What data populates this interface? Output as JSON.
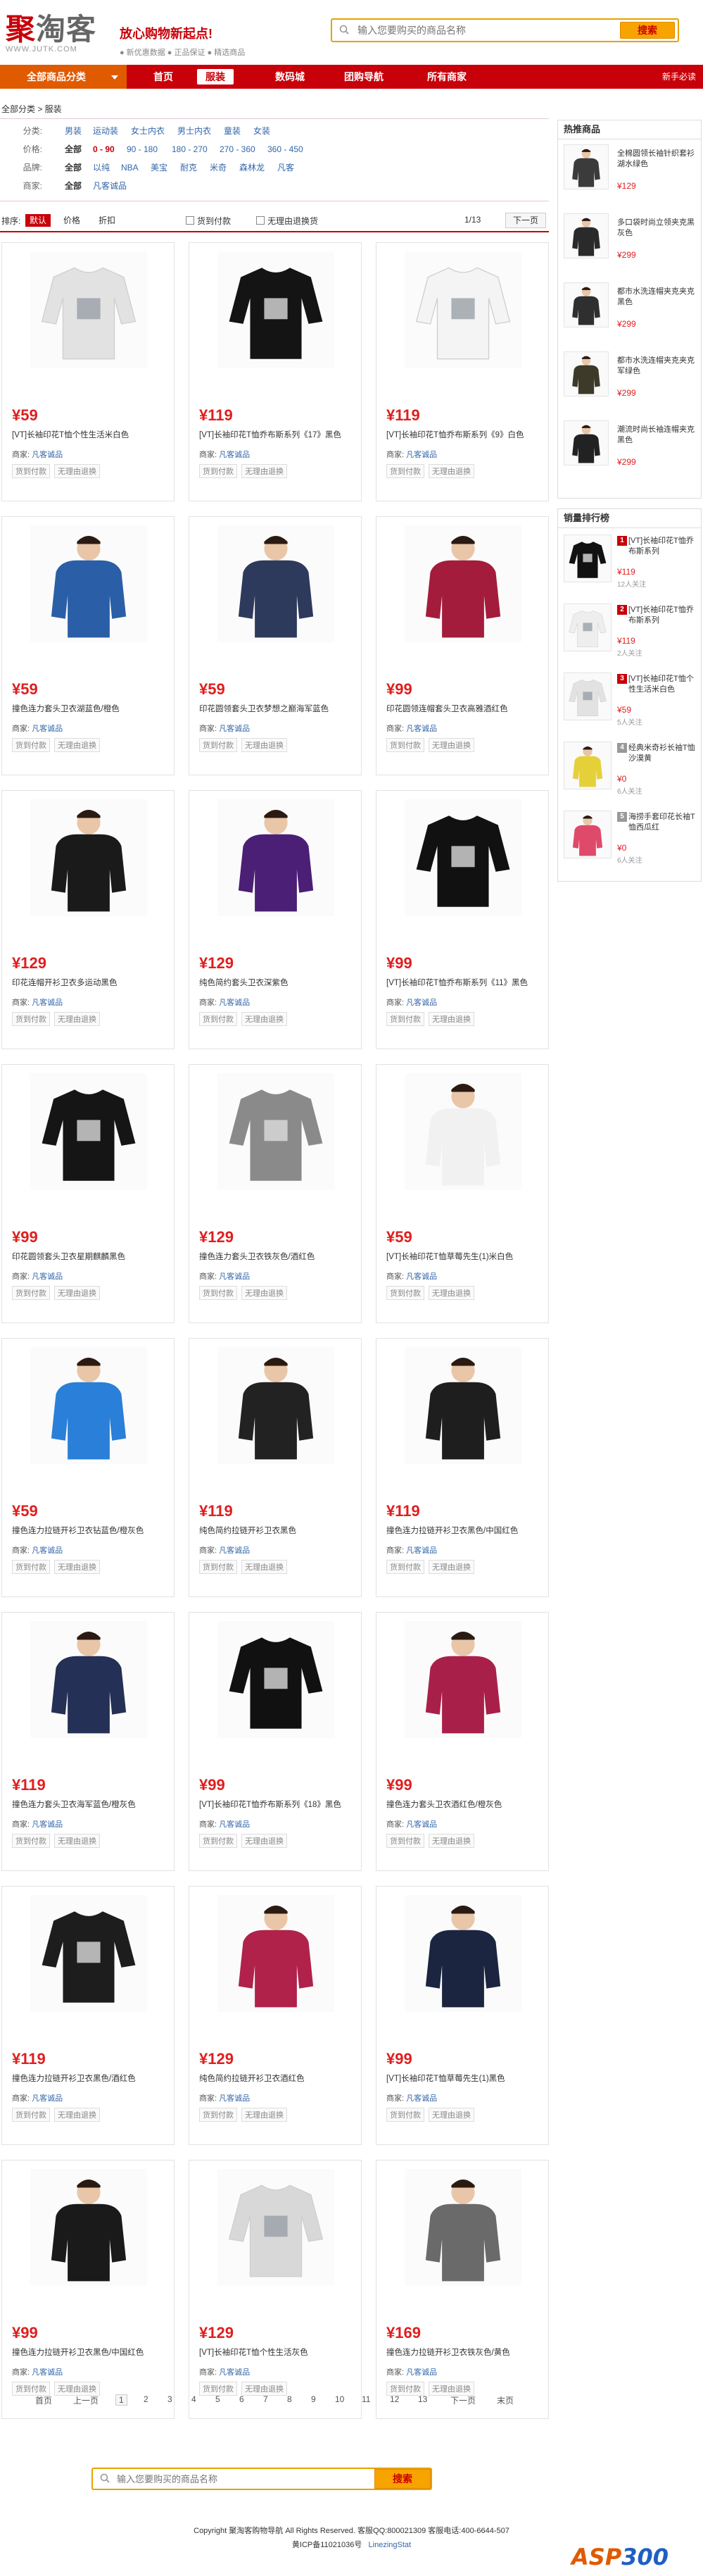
{
  "header": {
    "logo_text_a": "聚",
    "logo_text_b": "淘客",
    "logo_url": "WWW.JUTK.COM",
    "slogan": "放心购物新起点!",
    "slogan_sub": "● 新优惠数据  ● 正品保证  ● 精选商品",
    "search_placeholder": "输入您要购买的商品名称",
    "search_button": "搜索"
  },
  "nav": {
    "category": "全部商品分类",
    "items": [
      "首页",
      "服装",
      "数码城",
      "团购导航",
      "所有商家"
    ],
    "active_index": 1,
    "help": "新手必读"
  },
  "breadcrumb": "全部分类 > 服装",
  "filters": [
    {
      "label": "分类:",
      "all": "",
      "options": [
        "男装",
        "运动装",
        "女士内衣",
        "男士内衣",
        "童装",
        "女装"
      ]
    },
    {
      "label": "价格:",
      "all": "全部",
      "options": [
        "0 - 90",
        "90 - 180",
        "180 - 270",
        "270 - 360",
        "360 - 450"
      ]
    },
    {
      "label": "品牌:",
      "all": "全部",
      "options": [
        "以纯",
        "NBA",
        "美宝",
        "耐克",
        "米奇",
        "森林龙",
        "凡客"
      ]
    },
    {
      "label": "商家:",
      "all": "全部",
      "options": [
        "凡客诚品"
      ]
    }
  ],
  "sortbar": {
    "label": "排序:",
    "buttons": [
      "默认",
      "价格",
      "折扣"
    ],
    "checks": [
      "货到付款",
      "无理由退换货"
    ],
    "page": "1/13",
    "next": "下一页"
  },
  "products": [
    {
      "price": "¥59",
      "title": "[VT]长袖印花T恤个性生活米白色",
      "shirt": "#e2e2e2",
      "fig": "print"
    },
    {
      "price": "¥119",
      "title": "[VT]长袖印花T恤乔布斯系列《17》黑色",
      "shirt": "#141414",
      "fig": "print"
    },
    {
      "price": "¥119",
      "title": "[VT]长袖印花T恤乔布斯系列《9》白色",
      "shirt": "#f4f4f4",
      "fig": "print"
    },
    {
      "price": "¥59",
      "title": "撞色连力套头卫衣湖蓝色/橙色",
      "shirt": "#2a5fa8",
      "fig": "model"
    },
    {
      "price": "¥59",
      "title": "印花圆领套头卫衣梦想之巅海军蓝色",
      "shirt": "#2d3a5c",
      "fig": "model"
    },
    {
      "price": "¥99",
      "title": "印花圆领连帽套头卫衣高雅酒红色",
      "shirt": "#a31c3c",
      "fig": "model"
    },
    {
      "price": "¥129",
      "title": "印花连帽开衫卫衣多运动黑色",
      "shirt": "#1a1a1a",
      "fig": "model"
    },
    {
      "price": "¥129",
      "title": "纯色简约套头卫衣深紫色",
      "shirt": "#4b1f75",
      "fig": "model"
    },
    {
      "price": "¥99",
      "title": "[VT]长袖印花T恤乔布斯系列《11》黑色",
      "shirt": "#111111",
      "fig": "print"
    },
    {
      "price": "¥99",
      "title": "印花圆领套头卫衣星期麒麟黑色",
      "shirt": "#151515",
      "fig": "print"
    },
    {
      "price": "¥129",
      "title": "撞色连力套头卫衣铁灰色/酒红色",
      "shirt": "#8a8a8a",
      "fig": "print"
    },
    {
      "price": "¥59",
      "title": "[VT]长袖印花T恤草莓先生(1)米白色",
      "shirt": "#f1f1f1",
      "fig": "model"
    },
    {
      "price": "¥59",
      "title": "撞色连力拉链开衫卫衣钻蓝色/橙灰色",
      "shirt": "#2a7fd8",
      "fig": "model"
    },
    {
      "price": "¥119",
      "title": "纯色简约拉链开衫卫衣黑色",
      "shirt": "#222222",
      "fig": "model"
    },
    {
      "price": "¥119",
      "title": "撞色连力拉链开衫卫衣黑色/中国红色",
      "shirt": "#1e1e1e",
      "fig": "model"
    },
    {
      "price": "¥119",
      "title": "撞色连力套头卫衣海军蓝色/橙灰色",
      "shirt": "#243055",
      "fig": "model"
    },
    {
      "price": "¥99",
      "title": "[VT]长袖印花T恤乔布斯系列《18》黑色",
      "shirt": "#111111",
      "fig": "print"
    },
    {
      "price": "¥99",
      "title": "撞色连力套头卫衣酒红色/橙灰色",
      "shirt": "#a8204a",
      "fig": "model"
    },
    {
      "price": "¥119",
      "title": "撞色连力拉链开衫卫衣黑色/酒红色",
      "shirt": "#1d1d1d",
      "fig": "print"
    },
    {
      "price": "¥129",
      "title": "纯色简约拉链开衫卫衣酒红色",
      "shirt": "#b0224a",
      "fig": "model"
    },
    {
      "price": "¥99",
      "title": "[VT]长袖印花T恤草莓先生(1)黑色",
      "shirt": "#1b2540",
      "fig": "model"
    },
    {
      "price": "¥99",
      "title": "撞色连力拉链开衫卫衣黑色/中国红色",
      "shirt": "#1a1a1a",
      "fig": "model"
    },
    {
      "price": "¥129",
      "title": "[VT]长袖印花T恤个性生活灰色",
      "shirt": "#d8d8d8",
      "fig": "print"
    },
    {
      "price": "¥169",
      "title": "撞色连力拉链开衫卫衣铁灰色/黄色",
      "shirt": "#6a6a6a",
      "fig": "model"
    }
  ],
  "product_meta": {
    "seller_label": "商家:",
    "seller_name": "凡客诚品",
    "tag1": "货到付款",
    "tag2": "无理由退换"
  },
  "sidebar": {
    "hot_title": "热推商品",
    "hot": [
      {
        "title": "全棉圆领长袖针织套衫湖水绿色",
        "price": "¥129",
        "shirt": "#3b3b3b"
      },
      {
        "title": "多口袋时尚立领夹克黑灰色",
        "price": "¥299",
        "shirt": "#2a2a2a"
      },
      {
        "title": "都市水洗连帽夹克夹克黑色",
        "price": "¥299",
        "shirt": "#2f2f2f"
      },
      {
        "title": "都市水洗连帽夹克夹克军绿色",
        "price": "¥299",
        "shirt": "#3d3a2a"
      },
      {
        "title": "潮流时尚长袖连帽夹克黑色",
        "price": "¥299",
        "shirt": "#222222"
      }
    ],
    "rank_title": "销量排行榜",
    "rank": [
      {
        "no": "1",
        "title": "[VT]长袖印花T恤乔布斯系列",
        "price": "¥119",
        "fans": "12人关注",
        "shirt": "#111111"
      },
      {
        "no": "2",
        "title": "[VT]长袖印花T恤乔布斯系列",
        "price": "¥119",
        "fans": "2人关注",
        "shirt": "#eeeeee"
      },
      {
        "no": "3",
        "title": "[VT]长袖印花T恤个性生活米白色",
        "price": "¥59",
        "fans": "5人关注",
        "shirt": "#e2e2e2"
      },
      {
        "no": "4",
        "title": "经典米奇衫长袖T恤沙漠黄",
        "price": "¥0",
        "fans": "6人关注",
        "shirt": "#e6d03a"
      },
      {
        "no": "5",
        "title": "海捞手套印花长袖T恤西瓜红",
        "price": "¥0",
        "fans": "6人关注",
        "shirt": "#e04a6a"
      }
    ]
  },
  "pager": {
    "items": [
      "首页",
      "上一页",
      "1",
      "2",
      "3",
      "4",
      "5",
      "6",
      "7",
      "8",
      "9",
      "10",
      "11",
      "12",
      "13",
      "下一页",
      "末页"
    ],
    "current": "1"
  },
  "bottom_search": {
    "placeholder": "输入您要购买的商品名称",
    "button": "搜索"
  },
  "footer": {
    "line1": "Copyright 聚淘客购物导航  All Rights Reserved.   客服QQ:800021309   客服电话:400-6644-507",
    "icp": "黄ICP备11021036号",
    "powered": "LinezingStat",
    "logo_a": "ASP",
    "logo_b": "300"
  },
  "colors": {
    "brand_red": "#c8000a",
    "nav_orange": "#e05a00",
    "price_red": "#e01e1e",
    "search_border": "#e6a200",
    "link_blue": "#3366aa"
  }
}
